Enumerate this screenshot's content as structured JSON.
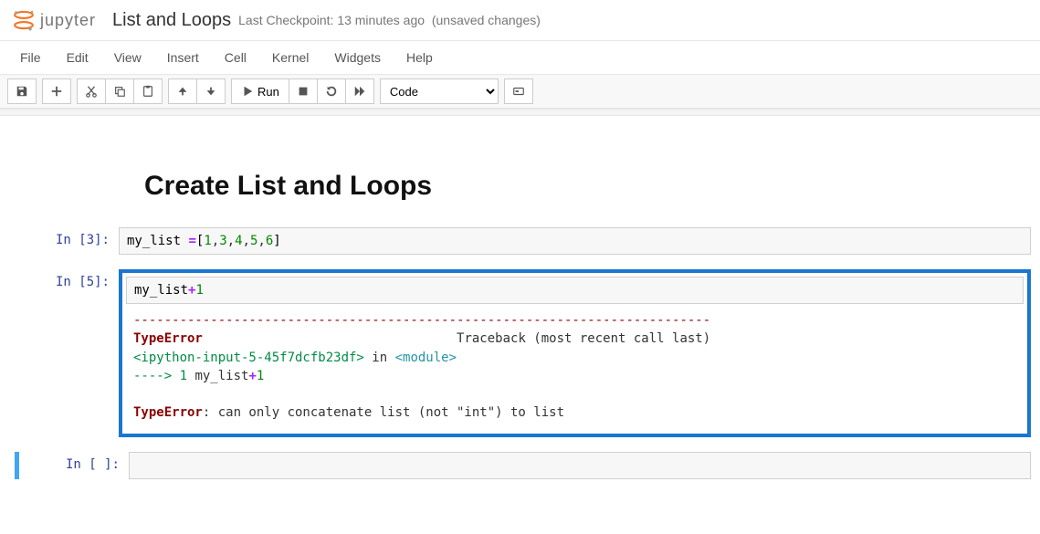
{
  "header": {
    "logo_text": "jupyter",
    "title": "List and Loops",
    "checkpoint": "Last Checkpoint: 13 minutes ago",
    "unsaved": "(unsaved changes)"
  },
  "menu": {
    "file": "File",
    "edit": "Edit",
    "view": "View",
    "insert": "Insert",
    "cell": "Cell",
    "kernel": "Kernel",
    "widgets": "Widgets",
    "help": "Help"
  },
  "toolbar": {
    "run_label": "Run",
    "cell_type": "Code"
  },
  "cells": {
    "markdown": {
      "heading": "Create List and Loops"
    },
    "c1": {
      "prompt": "In [3]:",
      "code": "my_list =[1,3,4,5,6]"
    },
    "c2": {
      "prompt": "In [5]:",
      "code": "my_list+1",
      "err_dashes": "---------------------------------------------------------------------------",
      "err_type": "TypeError",
      "err_traceback": "Traceback (most recent call last)",
      "err_src": "<ipython-input-5-45f7dcfb23df>",
      "err_in": " in ",
      "err_module": "<module>",
      "err_arrow": "----> 1 ",
      "err_line_code": "my_list+1",
      "err_final_label": "TypeError",
      "err_final_msg": ": can only concatenate list (not \"int\") to list"
    },
    "c3": {
      "prompt": "In [ ]:"
    }
  }
}
